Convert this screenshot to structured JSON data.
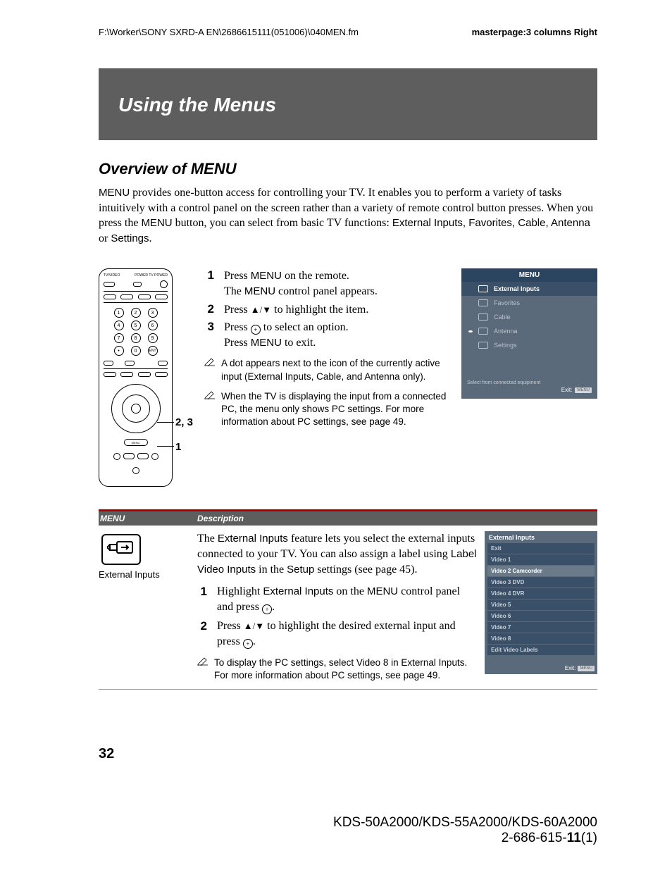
{
  "header": {
    "path": "F:\\Worker\\SONY SXRD-A EN\\2686615111(051006)\\040MEN.fm",
    "masterpage": "masterpage:3 columns Right"
  },
  "banner": "Using the Menus",
  "section_title": "Overview of MENU",
  "intro": {
    "p1a": "MENU",
    "p1b": " provides one-button access for controlling your TV. It enables you to perform a variety of tasks intuitively with a control panel on the screen rather than a variety of remote control button presses. When you press the ",
    "p1c": "MENU",
    "p1d": " button, you can select from basic TV functions: ",
    "p1e": "External Inputs",
    "p1f": ", ",
    "p1g": "Favorites",
    "p1h": ", ",
    "p1i": "Cable",
    "p1j": ", ",
    "p1k": "Antenna",
    "p1l": " or ",
    "p1m": "Settings",
    "p1n": "."
  },
  "remote_callouts": {
    "a": "2, 3",
    "b": "1"
  },
  "steps": {
    "s1": {
      "num": "1",
      "a": "Press ",
      "b": "MENU",
      "c": " on the remote.",
      "d": "The ",
      "e": "MENU",
      "f": " control panel appears."
    },
    "s2": {
      "num": "2",
      "a": "Press ",
      "arrows": "▲/▼",
      "b": " to highlight the item."
    },
    "s3": {
      "num": "3",
      "a": "Press ",
      "b": " to select an option.",
      "c": "Press ",
      "d": "MENU",
      "e": " to exit."
    }
  },
  "notes": {
    "n1": "A dot appears next to the icon of the currently active input (External Inputs, Cable, and Antenna only).",
    "n2": "When the TV is displaying the input from a connected PC, the menu only shows PC settings. For more information about PC settings, see page 49."
  },
  "osd_menu": {
    "title": "MENU",
    "items": [
      "External Inputs",
      "Favorites",
      "Cable",
      "Antenna",
      "Settings"
    ],
    "active_index": 0,
    "dot_index": 3,
    "footer": "Select from connected equipment",
    "exit_label": "Exit:",
    "exit_badge": "MENU"
  },
  "table": {
    "h1": "MENU",
    "h2": "Description",
    "row1": {
      "icon_label": "External Inputs",
      "desc_a": "The ",
      "desc_b": "External Inputs",
      "desc_c": " feature lets you select the external inputs connected to your TV. You can also assign a label using ",
      "desc_d": "Label Video Inputs",
      "desc_e": " in the ",
      "desc_f": "Setup",
      "desc_g": " settings (see page 45).",
      "s1": {
        "num": "1",
        "a": "Highlight ",
        "b": "External Inputs",
        "c": " on the ",
        "d": "MENU",
        "e": " control panel and press ",
        "f": "."
      },
      "s2": {
        "num": "2",
        "a": "Press ",
        "arrows": "▲/▼",
        "b": " to highlight the desired external input and press ",
        "c": "."
      },
      "note": "To display the PC settings, select Video 8 in External Inputs. For more information about PC settings, see page 49."
    },
    "osd_list": {
      "title": "External Inputs",
      "items": [
        "Exit",
        "Video 1",
        "Video 2  Camcorder",
        "Video 3  DVD",
        "Video 4  DVR",
        "Video 5",
        "Video 6",
        "Video 7",
        "Video 8",
        "Edit Video Labels"
      ],
      "selected_index": 2,
      "exit_label": "Exit:",
      "exit_badge": "MENU"
    }
  },
  "page_number": "32",
  "footer": {
    "models": "KDS-50A2000/KDS-55A2000/KDS-60A2000",
    "docnum_a": "2-686-615-",
    "docnum_b": "11",
    "docnum_c": "(1)"
  }
}
